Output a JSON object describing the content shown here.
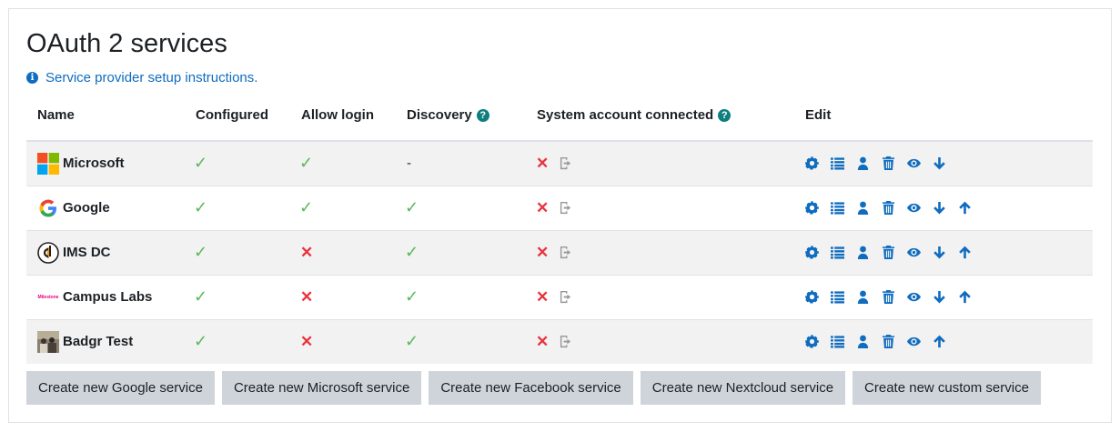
{
  "page": {
    "title": "OAuth 2 services",
    "help_link": "Service provider setup instructions."
  },
  "table": {
    "headers": [
      "Name",
      "Configured",
      "Allow login",
      "Discovery",
      "System account connected",
      "Edit"
    ],
    "rows": [
      {
        "name": "Microsoft",
        "logo": "microsoft-logo",
        "configured": "yes",
        "allow_login": "yes",
        "discovery": "-",
        "edit": [
          "gear-icon",
          "list-icon",
          "user-icon",
          "trash-icon",
          "eye-icon",
          "arrow-down-icon"
        ]
      },
      {
        "name": "Google",
        "logo": "google-logo",
        "configured": "yes",
        "allow_login": "yes",
        "discovery": "yes",
        "edit": [
          "gear-icon",
          "list-icon",
          "user-icon",
          "trash-icon",
          "eye-icon",
          "arrow-down-icon",
          "arrow-up-icon"
        ]
      },
      {
        "name": "IMS DC",
        "logo": "ims-logo",
        "configured": "yes",
        "allow_login": "no",
        "discovery": "yes",
        "edit": [
          "gear-icon",
          "list-icon",
          "user-icon",
          "trash-icon",
          "eye-icon",
          "arrow-down-icon",
          "arrow-up-icon"
        ]
      },
      {
        "name": "Campus Labs",
        "logo": "campus-labs-logo",
        "logo_text": "Milestone",
        "configured": "yes",
        "allow_login": "no",
        "discovery": "yes",
        "edit": [
          "gear-icon",
          "list-icon",
          "user-icon",
          "trash-icon",
          "eye-icon",
          "arrow-down-icon",
          "arrow-up-icon"
        ]
      },
      {
        "name": "Badgr Test",
        "logo": "badgr-photo",
        "configured": "yes",
        "allow_login": "no",
        "discovery": "yes",
        "edit": [
          "gear-icon",
          "list-icon",
          "user-icon",
          "trash-icon",
          "eye-icon",
          "arrow-up-icon"
        ]
      }
    ]
  },
  "buttons": [
    "Create new Google service",
    "Create new Microsoft service",
    "Create new Facebook service",
    "Create new Nextcloud service",
    "Create new custom service"
  ],
  "icons": {
    "check": "✓",
    "cross": "✕",
    "help": "?",
    "info": "i"
  },
  "colors": {
    "link": "#0f6cbf",
    "check": "#5cb85c",
    "cross": "#e8343f",
    "button_bg": "#ced4da"
  }
}
